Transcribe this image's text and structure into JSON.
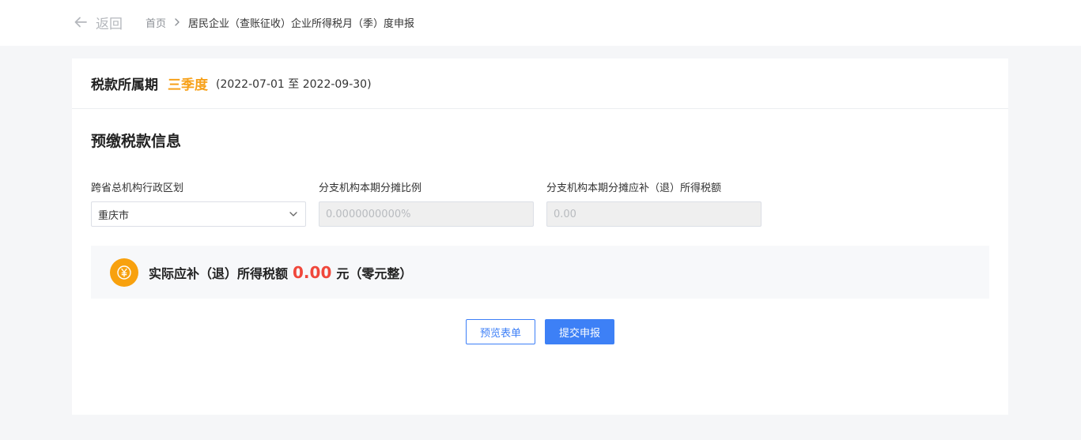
{
  "header": {
    "back_label": "返回",
    "breadcrumb": {
      "home": "首页",
      "current": "居民企业（查账征收）企业所得税月（季）度申报"
    }
  },
  "period": {
    "label": "税款所属期",
    "value": "三季度",
    "range": "(2022-07-01 至 2022-09-30)"
  },
  "section": {
    "title": "预缴税款信息"
  },
  "fields": {
    "region": {
      "label": "跨省总机构行政区划",
      "value": "重庆市"
    },
    "ratio": {
      "label": "分支机构本期分摊比例",
      "value": "0.0000000000%"
    },
    "amount": {
      "label": "分支机构本期分摊应补（退）所得税额",
      "value": "0.00"
    }
  },
  "result": {
    "label": "实际应补（退）所得税额",
    "amount": "0.00",
    "unit": "元（零元整）"
  },
  "buttons": {
    "preview": "预览表单",
    "submit": "提交申报"
  },
  "colors": {
    "accent_orange": "#f7a11a",
    "amount_red": "#f0473b",
    "primary_blue": "#3d80f6"
  },
  "icons": {
    "back": "arrow-left-icon",
    "breadcrumb_separator": "chevron-right-icon",
    "select_arrow": "chevron-down-icon",
    "result": "yuan-coin-icon"
  }
}
